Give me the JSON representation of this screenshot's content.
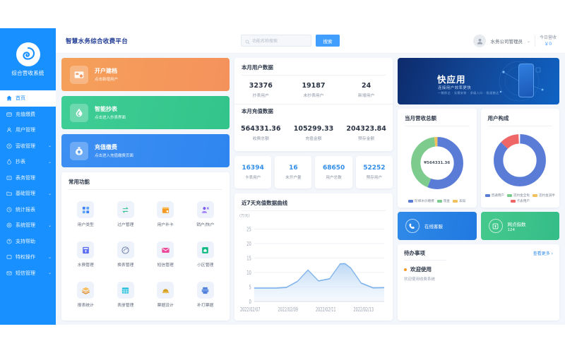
{
  "brand": {
    "name": "综合营收系统",
    "logo_icon": "water-swirl-logo"
  },
  "sidebar": {
    "items": [
      {
        "label": "首页",
        "icon": "home-icon",
        "active": true,
        "arrow": ""
      },
      {
        "label": "充值缴费",
        "icon": "wallet-icon",
        "active": false,
        "arrow": ""
      },
      {
        "label": "用户管理",
        "icon": "user-icon",
        "active": false,
        "arrow": ""
      },
      {
        "label": "营收管理",
        "icon": "coin-icon",
        "active": false,
        "arrow": "⌄"
      },
      {
        "label": "抄表",
        "icon": "drop-icon",
        "active": false,
        "arrow": "⌄"
      },
      {
        "label": "表务管理",
        "icon": "meter-icon",
        "active": false,
        "arrow": ""
      },
      {
        "label": "基础管理",
        "icon": "folder-icon",
        "active": false,
        "arrow": "⌄"
      },
      {
        "label": "统计报表",
        "icon": "clock-chart-icon",
        "active": false,
        "arrow": ""
      },
      {
        "label": "系统管理",
        "icon": "gear-icon",
        "active": false,
        "arrow": "⌄"
      },
      {
        "label": "支持帮助",
        "icon": "question-icon",
        "active": false,
        "arrow": ""
      },
      {
        "label": "特权操作",
        "icon": "shield-icon",
        "active": false,
        "arrow": "⌄"
      },
      {
        "label": "短信管理",
        "icon": "message-icon",
        "active": false,
        "arrow": "⌄"
      }
    ]
  },
  "topbar": {
    "title": "智慧水务综合收费平台",
    "search_placeholder": "功能名称搜索",
    "search_value": "",
    "search_button": "搜索",
    "user_name": "水务公司管理员",
    "revenue_label": "今日营收",
    "revenue_value": "￥0"
  },
  "actions": [
    {
      "title": "开户建档",
      "sub": "点击新增用户",
      "icon": "card-open-icon",
      "color": "#f5975c"
    },
    {
      "title": "智能抄表",
      "sub": "点击进入抄表界面",
      "icon": "water-drop-icon",
      "color": "#35c48c"
    },
    {
      "title": "充值缴费",
      "sub": "点击进入充值缴费页面",
      "icon": "money-bag-icon",
      "color": "#2f86f0"
    }
  ],
  "common_functions": {
    "title": "常用功能",
    "items": [
      {
        "label": "用户类型",
        "icon": "grid-blocks-icon",
        "color": "#3b82f6"
      },
      {
        "label": "过户管理",
        "icon": "transfer-icon",
        "color": "#34c38f"
      },
      {
        "label": "用户补卡",
        "icon": "calendar-card-icon",
        "color": "#f59a23"
      },
      {
        "label": "销户/恢户",
        "icon": "user-remove-icon",
        "color": "#7c5cf0"
      },
      {
        "label": "水费管理",
        "icon": "bill-icon",
        "color": "#5b6ef5"
      },
      {
        "label": "换表管理",
        "icon": "meter-swap-icon",
        "color": "#6b7fa8"
      },
      {
        "label": "短信管理",
        "icon": "envelope-icon",
        "color": "#ec4899"
      },
      {
        "label": "小区管理",
        "icon": "building-icon",
        "color": "#10b981"
      },
      {
        "label": "报表统计",
        "icon": "layers-icon",
        "color": "#f59a23"
      },
      {
        "label": "表册管理",
        "icon": "table-grid-icon",
        "color": "#06b6d4"
      },
      {
        "label": "票据设计",
        "icon": "receipt-icon",
        "color": "#d4a024"
      },
      {
        "label": "补打票据",
        "icon": "printer-icon",
        "color": "#4f7fd8"
      }
    ]
  },
  "user_data": {
    "title": "本月用户数据",
    "cells": [
      {
        "value": "32376",
        "label": "抄表用户"
      },
      {
        "value": "19187",
        "label": "未抄表用户"
      },
      {
        "value": "24",
        "label": "新增用户"
      }
    ]
  },
  "recharge_data": {
    "title": "本月充值数据",
    "cells": [
      {
        "value": "564331.36",
        "label": "收费总额"
      },
      {
        "value": "105299.33",
        "label": "充值金额"
      },
      {
        "value": "204323.84",
        "label": "预存金额"
      }
    ]
  },
  "kpis": [
    {
      "value": "16394",
      "label": "卡表用户"
    },
    {
      "value": "16",
      "label": "未开户量"
    },
    {
      "value": "68650",
      "label": "用户总数"
    },
    {
      "value": "52252",
      "label": "预存用户"
    }
  ],
  "banner": {
    "title": "快应用",
    "subtitle": "连接用户效率更快",
    "tags": "一触即达 · 无需安装 · 多级入口 · 极速触达"
  },
  "todo": {
    "title": "待办事项",
    "more": "查看更多 ›",
    "item_title": "欢迎使用",
    "item_desc": "欢迎使用收费系统"
  },
  "mini_cards": [
    {
      "title": "在线客服",
      "sub": "",
      "icon": "phone-icon",
      "color": "#2079e0"
    },
    {
      "title": "网点指数",
      "sub": "124",
      "icon": "location-box-icon",
      "color": "#35bd88"
    }
  ],
  "chart_data": [
    {
      "type": "area",
      "title": "近7天充值数据曲线",
      "ylabel": "(万元)",
      "xlabel": "",
      "x": [
        "2022/02/07",
        "2022/02/08",
        "2022/02/09",
        "2022/02/10",
        "2022/02/11",
        "2022/02/12",
        "2022/02/13"
      ],
      "values": [
        2.4,
        2.4,
        2.5,
        7.1,
        4.2,
        13.0,
        2.6
      ],
      "yticks": [
        0,
        5,
        10,
        15,
        20,
        25
      ],
      "ylim": [
        0,
        25
      ],
      "xticklabels": [
        "2022/02/07",
        "2022/02/09",
        "2022/02/11",
        "2022/02/13"
      ],
      "grid": true,
      "line_color": "#7fb3ec",
      "fill_color": "#d6e7f9"
    },
    {
      "type": "pie",
      "title": "当月营收总额",
      "center_label": "¥564331.36",
      "labels": [
        "阶梯水价缴费",
        "现金",
        "未知"
      ],
      "values": [
        56,
        42,
        2
      ],
      "colors": [
        "#5b7cd6",
        "#7ecb8e",
        "#f0c15c"
      ],
      "legend": "bottom"
    },
    {
      "type": "pie",
      "title": "用户构成",
      "labels": [
        "普通用户",
        "违约金全免",
        "违约金减半",
        "卡表用户"
      ],
      "values": [
        80,
        0,
        0,
        12
      ],
      "colors": [
        "#5b7cd6",
        "#7ecb8e",
        "#f0c15c",
        "#ee6666"
      ],
      "legend": "bottom"
    }
  ]
}
